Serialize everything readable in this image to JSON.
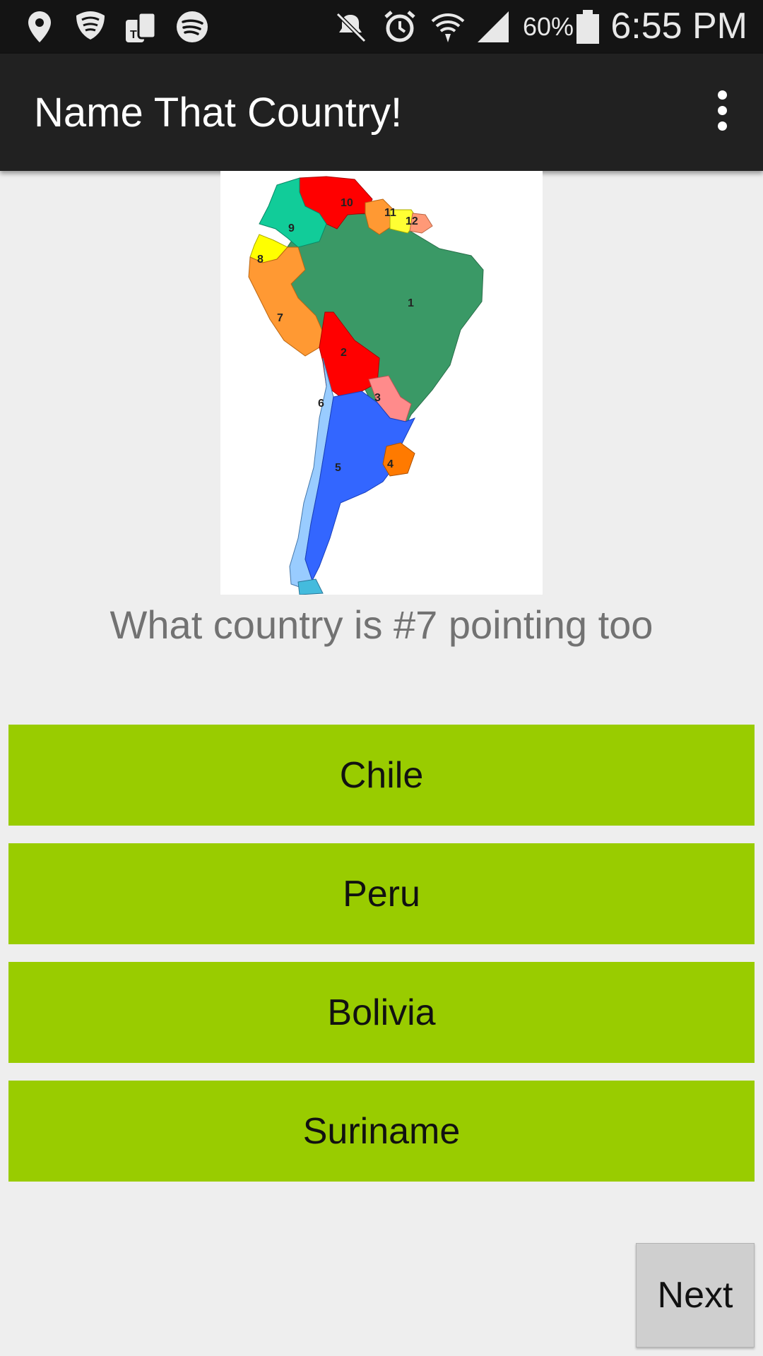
{
  "status_bar": {
    "icons": [
      "location-icon",
      "shield-icon",
      "tmobile-icon",
      "spotify-icon",
      "mute-icon",
      "alarm-icon",
      "wifi-icon",
      "signal-icon",
      "battery-icon"
    ],
    "battery_percent": "60%",
    "time": "6:55 PM"
  },
  "app_bar": {
    "title": "Name That Country!"
  },
  "map": {
    "labels": [
      "1",
      "2",
      "3",
      "4",
      "5",
      "6",
      "7",
      "8",
      "9",
      "10",
      "11",
      "12"
    ],
    "colors": {
      "brazil": "#3a9966",
      "bolivia": "#ff0000",
      "paraguay": "#ff8b8b",
      "uruguay": "#ff7a00",
      "argentina": "#3366ff",
      "chile": "#99ccff",
      "peru": "#ff9933",
      "ecuador": "#ffff00",
      "colombia": "#11cc99",
      "venezuela": "#ff0000",
      "guyana": "#ff9933",
      "suriname": "#ffff33"
    }
  },
  "question": "What country is #7 pointing too",
  "answers": [
    "Chile",
    "Peru",
    "Bolivia",
    "Suriname"
  ],
  "next_label": "Next",
  "colors": {
    "answer_bg": "#99cc00",
    "background": "#eeeeee",
    "app_bar": "#212121",
    "status_bar": "#141414"
  }
}
